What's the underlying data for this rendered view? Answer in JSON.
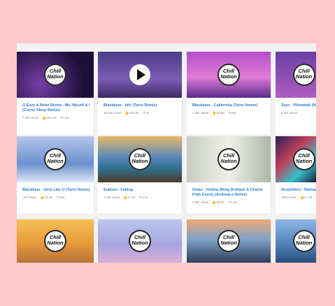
{
  "logo_text": [
    "Chill",
    "Nation"
  ],
  "rows": [
    [
      {
        "title": "G-Eazy & Bebe Rexha - Me, Myself & I (Cocno Sleep Remix)",
        "views": "7.2M views",
        "likes": "254.1K",
        "comments": "4.2K"
      },
      {
        "title": "Blackbear - Idfc (Tarro Remix)",
        "views": "15.6M views",
        "likes": "166.6K",
        "comments": "2K"
      },
      {
        "title": "Blackbear - Californiia (Tarro Remix)",
        "views": "3.3M views",
        "likes": "25.6K",
        "comments": "364"
      },
      {
        "title": "Zayn - Pillowtalk (Ni",
        "views": "6.5M views",
        "likes": "",
        "comments": ""
      }
    ],
    [
      {
        "title": "Blackbear - Girls Like U (Tarro Remix)",
        "views": ".3M views",
        "likes": "19.9K",
        "comments": "165"
      },
      {
        "title": "Subtact - Falling",
        "views": "3.1M views",
        "likes": "27.1K",
        "comments": "378"
      },
      {
        "title": "Drake - Hotline Bling (Kehlani & Charlie Puth Cover) (AndreaLa Remix)",
        "views": "4.9M views",
        "likes": "38.2K",
        "comments": "1.2K"
      },
      {
        "title": "Dropkillers - Batman",
        "views": "35M views",
        "likes": "41.5K",
        "comments": ""
      }
    ]
  ],
  "colors": {
    "page_bg": "#fdc9c9",
    "link": "#2a7bd0"
  }
}
